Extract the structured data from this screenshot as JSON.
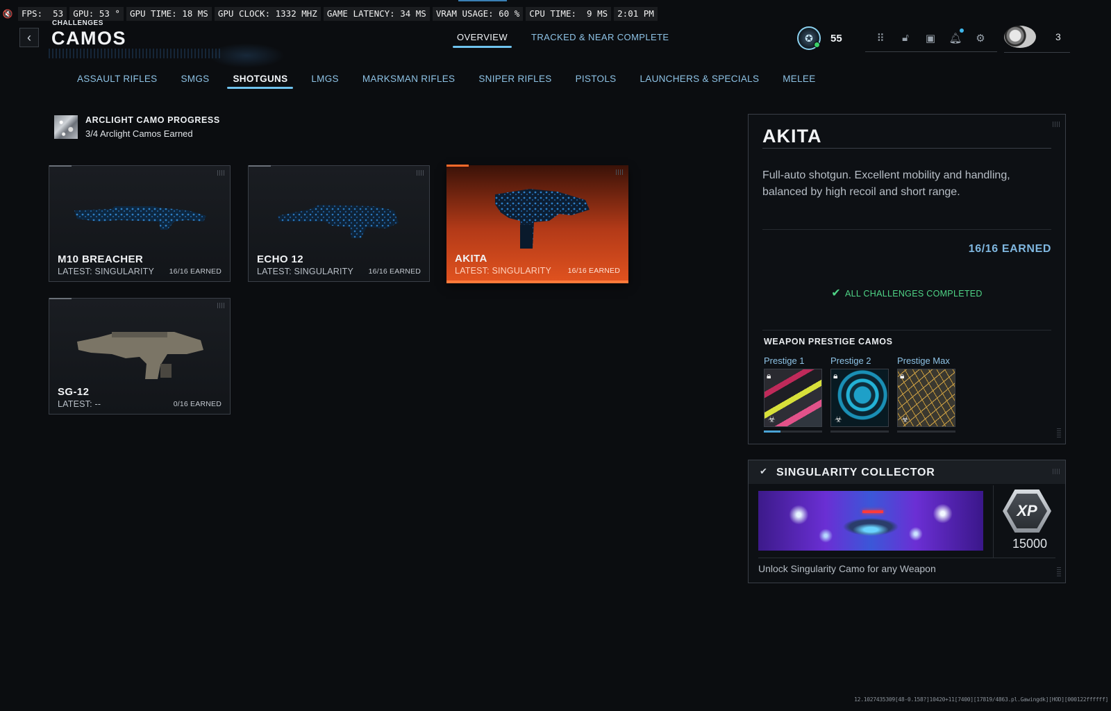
{
  "perf": {
    "items": [
      "FPS:  53",
      "GPU: 53 °",
      "GPU TIME: 18 MS",
      "GPU CLOCK: 1332 MHZ",
      "GAME LATENCY: 34 MS",
      "VRAM USAGE: 60 %",
      "CPU TIME:  9 MS",
      "2:01 PM"
    ]
  },
  "header": {
    "breadcrumb": "CHALLENGES",
    "title": "CAMOS",
    "tabs": [
      "OVERVIEW",
      "TRACKED & NEAR COMPLETE"
    ],
    "active_tab": 0,
    "rank_level": "55",
    "player_count": "3"
  },
  "categories": {
    "items": [
      "ASSAULT RIFLES",
      "SMGS",
      "SHOTGUNS",
      "LMGS",
      "MARKSMAN RIFLES",
      "SNIPER RIFLES",
      "PISTOLS",
      "LAUNCHERS & SPECIALS",
      "MELEE"
    ],
    "active": 2
  },
  "arclight": {
    "title": "ARCLIGHT CAMO PROGRESS",
    "subtitle": "3/4 Arclight Camos Earned"
  },
  "weapons": [
    {
      "name": "M10 BREACHER",
      "latest": "LATEST: SINGULARITY",
      "earned": "16/16 EARNED"
    },
    {
      "name": "ECHO 12",
      "latest": "LATEST: SINGULARITY",
      "earned": "16/16 EARNED"
    },
    {
      "name": "AKITA",
      "latest": "LATEST: SINGULARITY",
      "earned": "16/16 EARNED"
    },
    {
      "name": "SG-12",
      "latest": "LATEST: --",
      "earned": "0/16 EARNED"
    }
  ],
  "detail": {
    "title": "AKITA",
    "description": "Full-auto shotgun. Excellent mobility and handling, balanced by high recoil and short range.",
    "earned": "16/16 EARNED",
    "status": "ALL CHALLENGES COMPLETED",
    "prestige_title": "WEAPON PRESTIGE CAMOS",
    "prestige": [
      {
        "label": "Prestige 1",
        "progress": 0.28
      },
      {
        "label": "Prestige 2",
        "progress": 0
      },
      {
        "label": "Prestige Max",
        "progress": 0
      }
    ]
  },
  "collector": {
    "title": "SINGULARITY COLLECTOR",
    "xp_label": "XP",
    "xp_value": "15000",
    "description": "Unlock Singularity Camo for any Weapon"
  },
  "build_string": "12.1027435309[48-0.158?]10420+11[7400][17819/4863.pl.Gawingdk][HOD][000122ffffff]"
}
